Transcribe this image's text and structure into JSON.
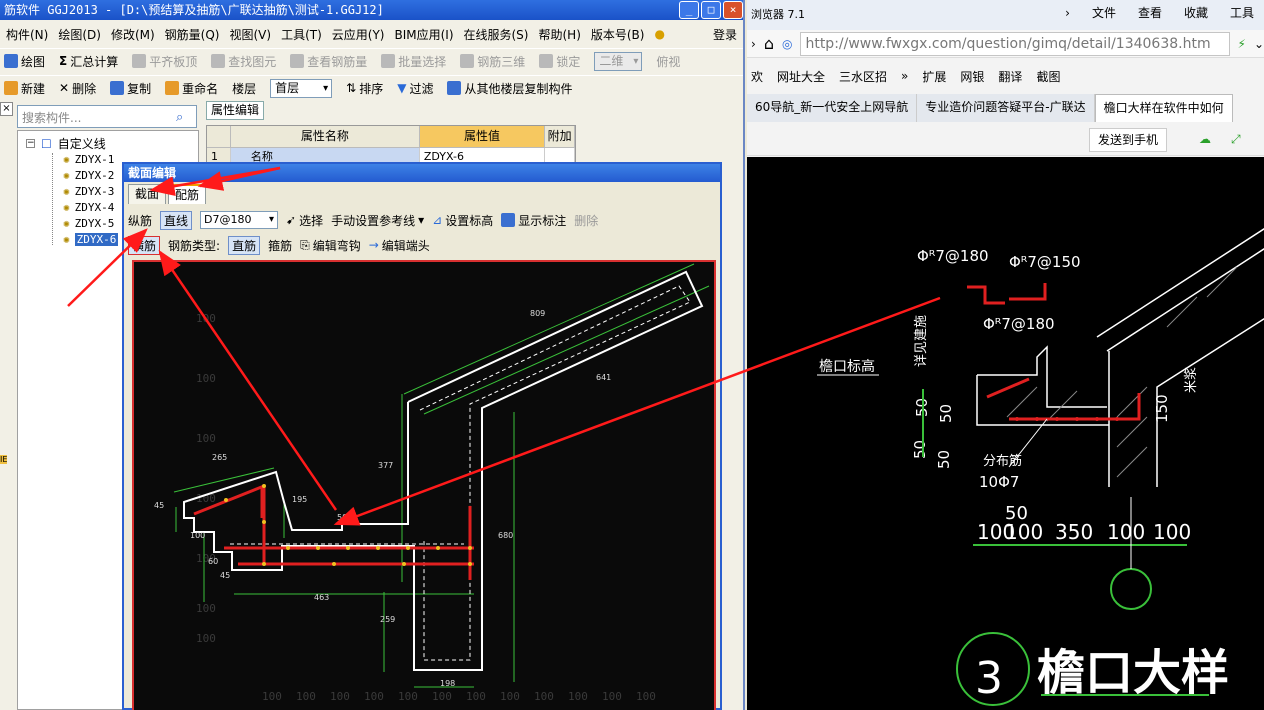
{
  "app": {
    "title": "筋软件 GGJ2013 - [D:\\预结算及抽筋\\广联达抽筋\\测试-1.GGJ12]",
    "window_controls": [
      "_",
      "□",
      "×"
    ],
    "menu": [
      "构件(N)",
      "绘图(D)",
      "修改(M)",
      "钢筋量(Q)",
      "视图(V)",
      "工具(T)",
      "云应用(Y)",
      "BIM应用(I)",
      "在线服务(S)",
      "帮助(H)",
      "版本号(B)"
    ],
    "login": "登录",
    "toolbar1": {
      "draw": "绘图",
      "summary": "汇总计算",
      "flat_slab": "平齐板顶",
      "find_element": "查找图元",
      "view_rebar": "查看钢筋量",
      "batch_select": "批量选择",
      "rebar_3d": "钢筋三维",
      "lock": "锁定",
      "view_mode": "二维",
      "view_angle": "俯视"
    },
    "toolbar2": {
      "new": "新建",
      "delete": "删除",
      "copy": "复制",
      "rename": "重命名",
      "floor_label": "楼层",
      "floor_value": "首层",
      "sort": "排序",
      "filter": "过滤",
      "copy_from_floor": "从其他楼层复制构件"
    },
    "side_tab": "×",
    "left_strip_text": "IE",
    "search": {
      "placeholder": "搜索构件..."
    },
    "tree": {
      "root": "自定义线",
      "items": [
        "ZDYX-1",
        "ZDYX-2",
        "ZDYX-3",
        "ZDYX-4",
        "ZDYX-5",
        "ZDYX-6"
      ],
      "selected_index": 5
    },
    "property_panel": {
      "tab": "属性编辑",
      "headers": [
        "属性名称",
        "属性值",
        "附加"
      ],
      "rows": [
        {
          "no": "1",
          "name": "名称",
          "value": "ZDYX-6"
        }
      ]
    }
  },
  "dialog": {
    "title": "截面编辑",
    "tabs": [
      "截面",
      "配筋"
    ],
    "active_tab": "配筋",
    "bar1": {
      "longitudinal": "纵筋",
      "line_type": "直线",
      "rebar_spec": "D7@180",
      "select": "选择",
      "manual_ref": "手动设置参考线",
      "set_elevation": "设置标高",
      "show_annotation": "显示标注",
      "delete": "删除"
    },
    "bar2": {
      "transverse": "横筋",
      "rebar_type_label": "钢筋类型:",
      "straight": "直筋",
      "stirrup": "箍筋",
      "edit_hook": "编辑弯钩",
      "edit_end": "编辑端头"
    },
    "dims": [
      "809",
      "641",
      "377",
      "265",
      "195",
      "680",
      "45",
      "100",
      "60",
      "45",
      "463",
      "259",
      "198",
      "50"
    ],
    "grid_labels": [
      "100",
      "100",
      "100",
      "100",
      "100",
      "100",
      "100",
      "100",
      "100",
      "100",
      "100",
      "100"
    ]
  },
  "browser": {
    "title": "浏览器 7.1",
    "menu": [
      "文件",
      "查看",
      "收藏",
      "工具"
    ],
    "url": "http://www.fwxgx.com/question/gimq/detail/1340638.htm",
    "bookmarks": [
      "网址大全",
      "三水区招",
      "扩展",
      "网银",
      "翻译",
      "截图"
    ],
    "tabs": [
      "60导航_新一代安全上网导航",
      "专业造价问题答疑平台-广联达",
      "檐口大样在软件中如何"
    ],
    "send_to_phone": "发送到手机"
  },
  "drawing": {
    "rebar_top_left": "Φᴿ7@180",
    "rebar_top_right": "Φᴿ7@150",
    "rebar_bottom": "Φᴿ7@180",
    "eave_label": "檐口标高",
    "vertical_label": "详见建施",
    "dims_vertical": [
      "50",
      "50",
      "50",
      "50"
    ],
    "dist_label": "分布筋",
    "dist_value": "10Φ7",
    "dim_top": "50",
    "dims_bottom": [
      "100",
      "100",
      "350",
      "100",
      "100"
    ],
    "label_150": "150",
    "label_right": "米浆",
    "detail_number": "3",
    "detail_title": "檐口大样"
  }
}
